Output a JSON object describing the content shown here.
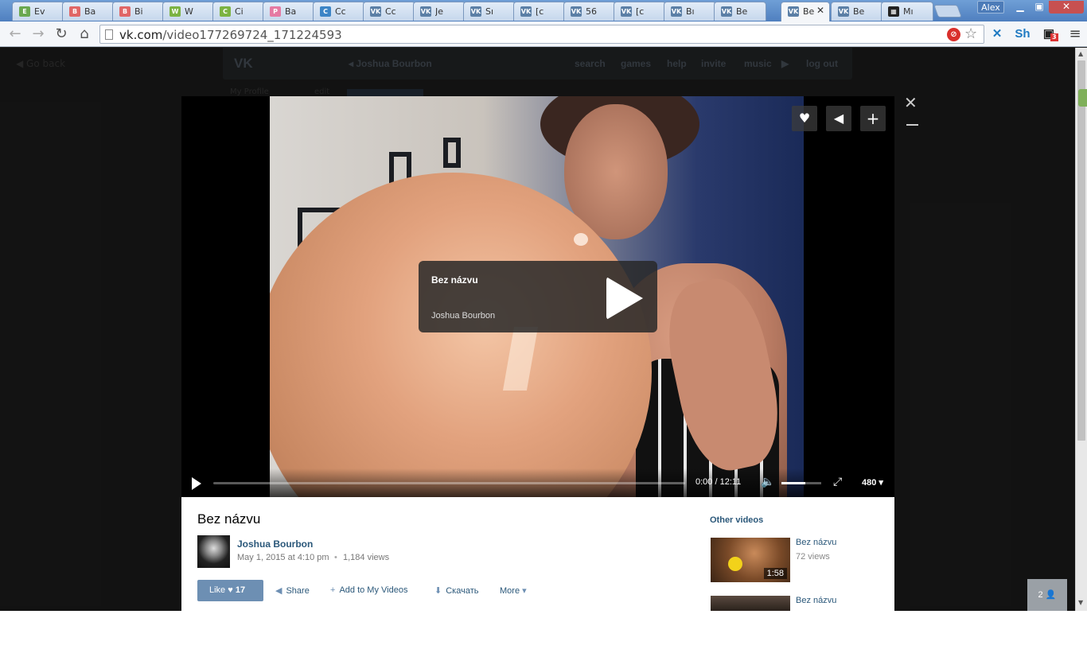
{
  "browser": {
    "tabs": [
      {
        "label": "Ev",
        "fav_color": "#6aa84f",
        "fav": "E"
      },
      {
        "label": "Ba",
        "fav_color": "#e06666",
        "fav": "B"
      },
      {
        "label": "Bi",
        "fav_color": "#e06666",
        "fav": "B"
      },
      {
        "label": "W",
        "fav_color": "#7cb342",
        "fav": "W"
      },
      {
        "label": "Ci",
        "fav_color": "#7cb342",
        "fav": "C"
      },
      {
        "label": "Ba",
        "fav_color": "#e57aa3",
        "fav": "P"
      },
      {
        "label": "Cc",
        "fav_color": "#3d85c6",
        "fav": "C"
      },
      {
        "label": "Cc",
        "fav_color": "#5b7fa6",
        "fav": "VK"
      },
      {
        "label": "Je",
        "fav_color": "#5b7fa6",
        "fav": "VK"
      },
      {
        "label": "Sı",
        "fav_color": "#5b7fa6",
        "fav": "VK"
      },
      {
        "label": "[c",
        "fav_color": "#5b7fa6",
        "fav": "VK"
      },
      {
        "label": "56",
        "fav_color": "#5b7fa6",
        "fav": "VK"
      },
      {
        "label": "[c",
        "fav_color": "#5b7fa6",
        "fav": "VK"
      },
      {
        "label": "Bı",
        "fav_color": "#5b7fa6",
        "fav": "VK"
      },
      {
        "label": "Be",
        "fav_color": "#5b7fa6",
        "fav": "VK"
      },
      {
        "label": "Be",
        "fav_color": "#5b7fa6",
        "fav": "VK",
        "active": true
      },
      {
        "label": "Be",
        "fav_color": "#5b7fa6",
        "fav": "VK"
      },
      {
        "label": "Mı",
        "fav_color": "#222222",
        "fav": "▦"
      }
    ],
    "user": "Alex",
    "url_host": "vk.com",
    "url_path": "/video177269724_171224593",
    "ext_badge": "3"
  },
  "vk": {
    "go_back": "Go back",
    "logo": "VK",
    "header_name": "Joshua Bourbon",
    "menu": [
      "search",
      "games",
      "help",
      "invite",
      "music",
      "log out"
    ],
    "side_profile": "My Profile",
    "side_edit": "edit"
  },
  "player": {
    "overlay_title": "Bez názvu",
    "overlay_author": "Joshua Bourbon",
    "time": "0:00 / 12:11",
    "quality": "480",
    "volume": 0.6,
    "progress": 0
  },
  "video": {
    "title": "Bez názvu",
    "author": "Joshua Bourbon",
    "date": "May 1, 2015 at 4:10 pm",
    "views": "1,184 views",
    "like_label": "Like",
    "like_count": "17",
    "share": "Share",
    "add": "Add to My Videos",
    "download": "Скачать",
    "more": "More"
  },
  "other": {
    "heading": "Other videos",
    "items": [
      {
        "title": "Bez názvu",
        "views": "72 views",
        "duration": "1:58"
      },
      {
        "title": "Bez názvu",
        "views": "",
        "duration": ""
      }
    ]
  },
  "people_count": "2"
}
